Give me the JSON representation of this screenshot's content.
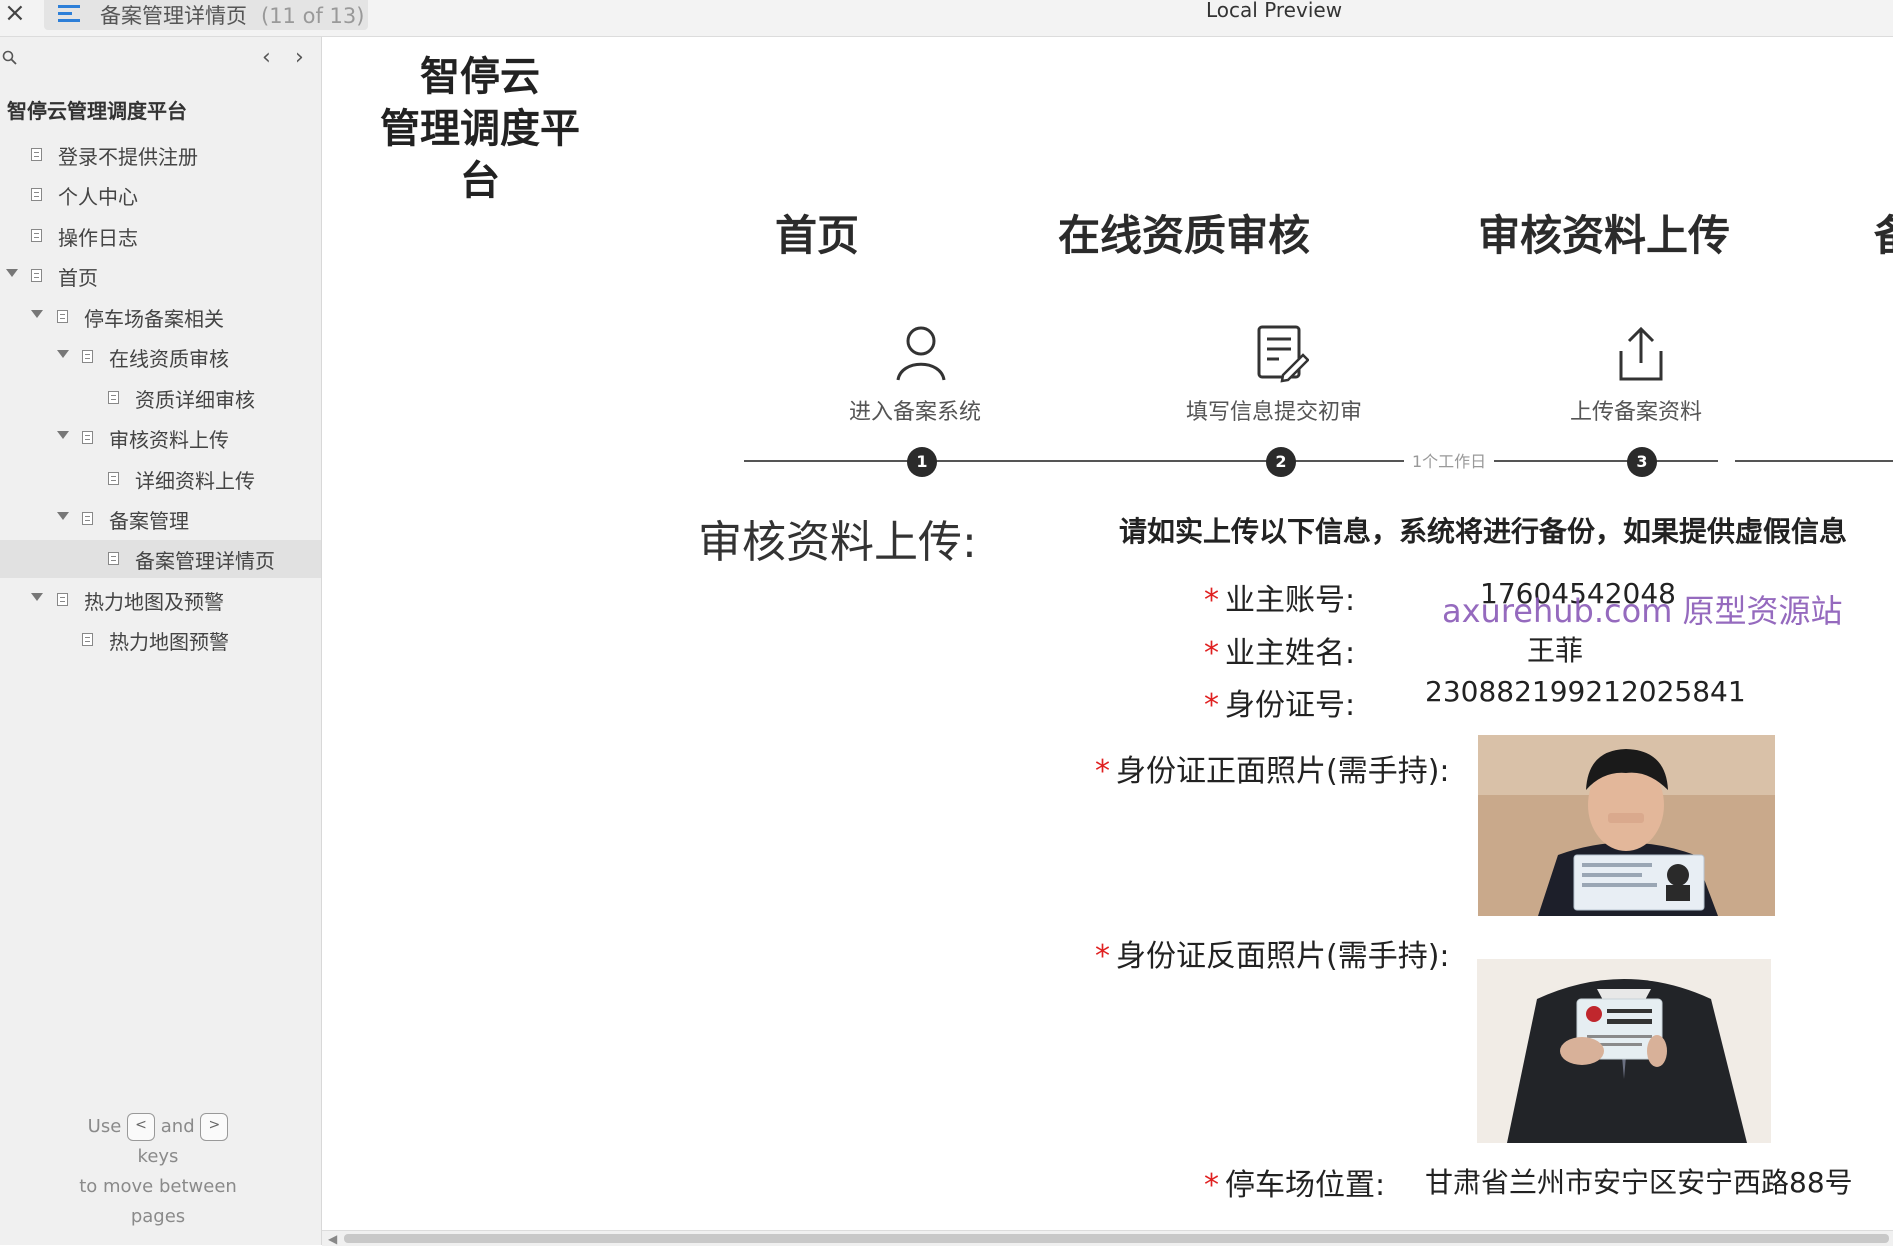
{
  "window": {
    "close_glyph": "×",
    "tab_title": "备案管理详情页",
    "tab_count": "(11 of 13)",
    "title": "Local Preview"
  },
  "sidebar": {
    "nav_prev": "‹",
    "nav_next": "›",
    "site_title": "智停云管理调度平台",
    "items": [
      {
        "label": "登录不提供注册"
      },
      {
        "label": "个人中心"
      },
      {
        "label": "操作日志"
      },
      {
        "label": "首页"
      },
      {
        "label": "停车场备案相关"
      },
      {
        "label": "在线资质审核"
      },
      {
        "label": "资质详细审核"
      },
      {
        "label": "审核资料上传"
      },
      {
        "label": "详细资料上传"
      },
      {
        "label": "备案管理"
      },
      {
        "label": "备案管理详情页"
      },
      {
        "label": "热力地图及预警"
      },
      {
        "label": "热力地图预警"
      }
    ],
    "selected_item": "备案管理详情页",
    "help": {
      "use": "Use",
      "key_prev": "<",
      "and": "and",
      "key_next": ">",
      "keys": "keys",
      "line3": "to move between",
      "line4": "pages"
    }
  },
  "brand": {
    "line1": "智停云",
    "line2": "管理调度平台"
  },
  "steps": {
    "headings": [
      "首页",
      "在线资质审核",
      "审核资料上传",
      "备"
    ],
    "captions": [
      "进入备案系统",
      "填写信息提交初审",
      "上传备案资料"
    ],
    "numbers": [
      "1",
      "2",
      "3"
    ],
    "duration_note": "1个工作日",
    "icons": [
      "user-icon",
      "edit-form-icon",
      "upload-icon"
    ]
  },
  "form": {
    "section_title": "审核资料上传:",
    "notice": "请如实上传以下信息，系统将进行备份，如果提供虚假信息",
    "required_mark": "*",
    "fields": {
      "owner_account": {
        "label": "业主账号:",
        "value": "17604542048"
      },
      "owner_name": {
        "label": "业主姓名:",
        "value": "王菲"
      },
      "id_number": {
        "label": "身份证号:",
        "value": "230882199212025841"
      },
      "id_front": {
        "label": "身份证正面照片(需手持):"
      },
      "id_back": {
        "label": "身份证反面照片(需手持):"
      },
      "parking_location": {
        "label": "停车场位置:",
        "value": "甘肃省兰州市安宁区安宁西路88号"
      }
    }
  },
  "watermark": "axurehub.com 原型资源站",
  "colors": {
    "required": "#e02020",
    "watermark": "#8a5ab8",
    "accent_icon": "#2d7fd8"
  }
}
